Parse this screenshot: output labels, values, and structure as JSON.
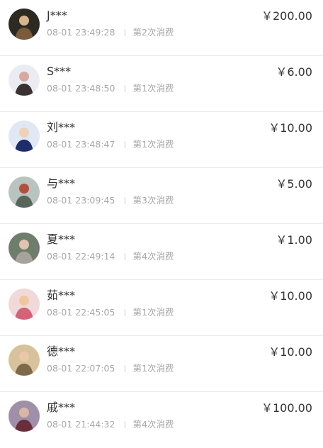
{
  "records": [
    {
      "name": "J***",
      "time": "08-01 23:49:28",
      "count": "第2次消费",
      "amount": "￥200.00",
      "avatar_colors": [
        "#2d2a22",
        "#7c5a3c",
        "#d9b38c"
      ]
    },
    {
      "name": "S***",
      "time": "08-01 23:48:50",
      "count": "第1次消费",
      "amount": "￥6.00",
      "avatar_colors": [
        "#e9edf2",
        "#3a3232",
        "#d8a8a0"
      ]
    },
    {
      "name": "刘***",
      "time": "08-01 23:48:47",
      "count": "第1次消费",
      "amount": "￥10.00",
      "avatar_colors": [
        "#dfe8f3",
        "#1d2c6b",
        "#f1d0b9"
      ]
    },
    {
      "name": "与***",
      "time": "08-01 23:09:45",
      "count": "第3次消费",
      "amount": "￥5.00",
      "avatar_colors": [
        "#b9c3bf",
        "#57655a",
        "#b2503e"
      ]
    },
    {
      "name": "夏***",
      "time": "08-01 22:49:14",
      "count": "第4次消费",
      "amount": "￥1.00",
      "avatar_colors": [
        "#6d7e6b",
        "#a7a39b",
        "#e3c2b0"
      ]
    },
    {
      "name": "茹***",
      "time": "08-01 22:45:05",
      "count": "第1次消费",
      "amount": "￥10.00",
      "avatar_colors": [
        "#f1d9da",
        "#d46378",
        "#f0c79c"
      ]
    },
    {
      "name": "德***",
      "time": "08-01 22:07:05",
      "count": "第1次消费",
      "amount": "￥10.00",
      "avatar_colors": [
        "#d8c29b",
        "#7c6a4a",
        "#e9c9a8"
      ]
    },
    {
      "name": "戚***",
      "time": "08-01 21:44:32",
      "count": "第4次消费",
      "amount": "￥100.00",
      "avatar_colors": [
        "#a08fa8",
        "#6a2e3b",
        "#d9b7a4"
      ]
    }
  ]
}
